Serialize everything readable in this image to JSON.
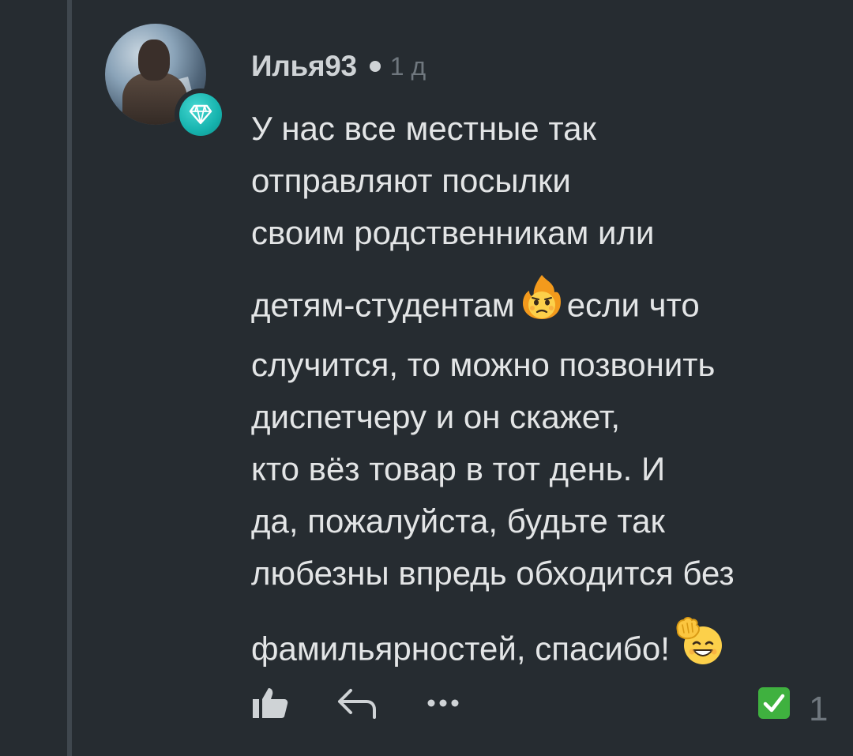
{
  "comment": {
    "author": "Илья93",
    "time": "1 д",
    "lines": [
      "У нас все местные так",
      "отправляют посылки",
      "своим родственникам или",
      "детям-студентам",
      "если что",
      "случится, то можно позвонить",
      "диспетчеру и он скажет,",
      "кто вёз товар в тот день. И",
      "да, пожалуйста, будьте так",
      "любезны впредь обходится без",
      "фамильярностей, спасибо!"
    ],
    "score": "1"
  },
  "icons": {
    "avatar": "user-avatar",
    "badge": "diamond-icon",
    "emoji_1": "flushed-face-on-fire-icon",
    "emoji_2": "waving-smile-icon",
    "like": "thumbs-up-icon",
    "reply": "reply-arrow-icon",
    "more": "more-dots-icon",
    "check": "check-mark-button-icon"
  },
  "colors": {
    "background": "#262c31",
    "text": "#e3e5e6",
    "muted": "#6f777e",
    "badge": "#16b3ae",
    "check": "#3fb13f"
  }
}
